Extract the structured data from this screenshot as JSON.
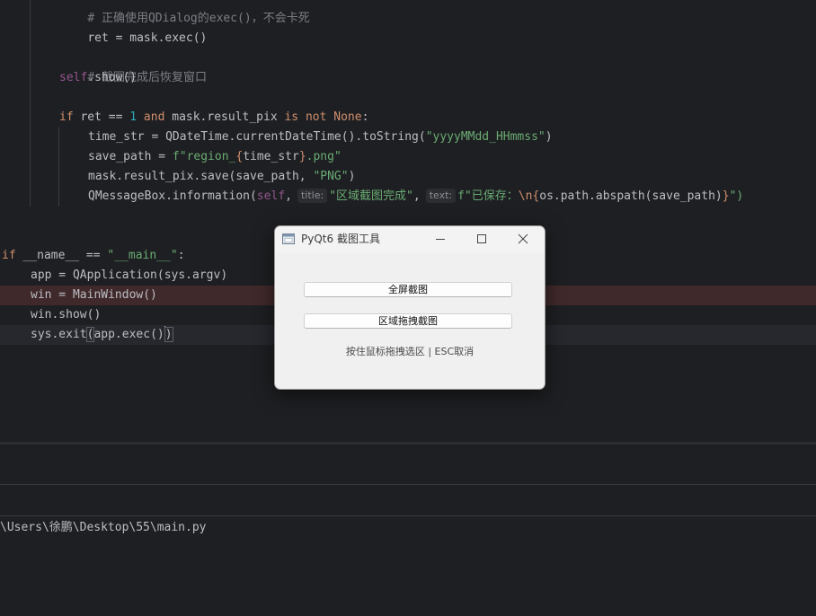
{
  "editor": {
    "lines": {
      "l0_comment": "# 正确使用QDialog的exec()，不会卡死",
      "l1_ret": "ret = mask.exec()",
      "l3_comment": "# 截图完成后恢复窗口",
      "l4_self": "self",
      "l4_rest": ".show()",
      "l6_if": "if",
      "l6_a": " ret == ",
      "l6_num": "1",
      "l6_and": " and",
      "l6_b": " mask.result_pix ",
      "l6_is": "is not",
      "l6_none": " None",
      "l6_colon": ":",
      "l7_a": "time_str = QDateTime.currentDateTime().toString(",
      "l7_str": "\"yyyyMMdd_HHmmss\"",
      "l7_end": ")",
      "l8_a": "save_path = ",
      "l8_f": "f\"region_",
      "l8_brace_open": "{",
      "l8_mid": "time_str",
      "l8_brace_close": "}",
      "l8_str2": ".png\"",
      "l9_a": "mask.result_pix.save(save_path, ",
      "l9_str": "\"PNG\"",
      "l9_end": ")",
      "l10_a": "QMessageBox.information(",
      "l10_self": "self",
      "l10_comma": ",",
      "l10_hint_title": "title:",
      "l10_str1": "\"区域截图完成\"",
      "l10_comma2": ",",
      "l10_hint_text": "text:",
      "l10_str2": "f\"已保存：",
      "l10_esc": "\\n",
      "l10_brace_open": "{",
      "l10_expr": "os.path.abspath(save_path)",
      "l10_brace_close": "}",
      "l10_end": "\")",
      "l12_if": "if",
      "l12_name": " __name__",
      "l12_eq": " == ",
      "l12_str": "\"__main__\"",
      "l12_colon": ":",
      "l13": "app = QApplication(sys.argv)",
      "l14": "win = MainWindow()",
      "l15": "win.show()",
      "l16_a": "sys.exit",
      "l16_paren_open": "(",
      "l16_b": "app.exec()",
      "l16_paren_close": ")"
    }
  },
  "terminal": {
    "path_line": "\\Users\\徐鹏\\Desktop\\55\\main.py"
  },
  "dialog": {
    "title": "PyQt6 截图工具",
    "fullscreen_button": "全屏截图",
    "region_button": "区域拖拽截图",
    "hint": "按住鼠标拖拽选区 | ESC取消"
  },
  "colors": {
    "editor_bg": "#1e1f22",
    "keyword": "#cf8e6d",
    "string": "#6aab73",
    "number": "#2aacb8",
    "comment": "#7a7e85",
    "self": "#94558d",
    "breakpoint_line": "#40292b",
    "dialog_bg": "#f0f0f0"
  }
}
